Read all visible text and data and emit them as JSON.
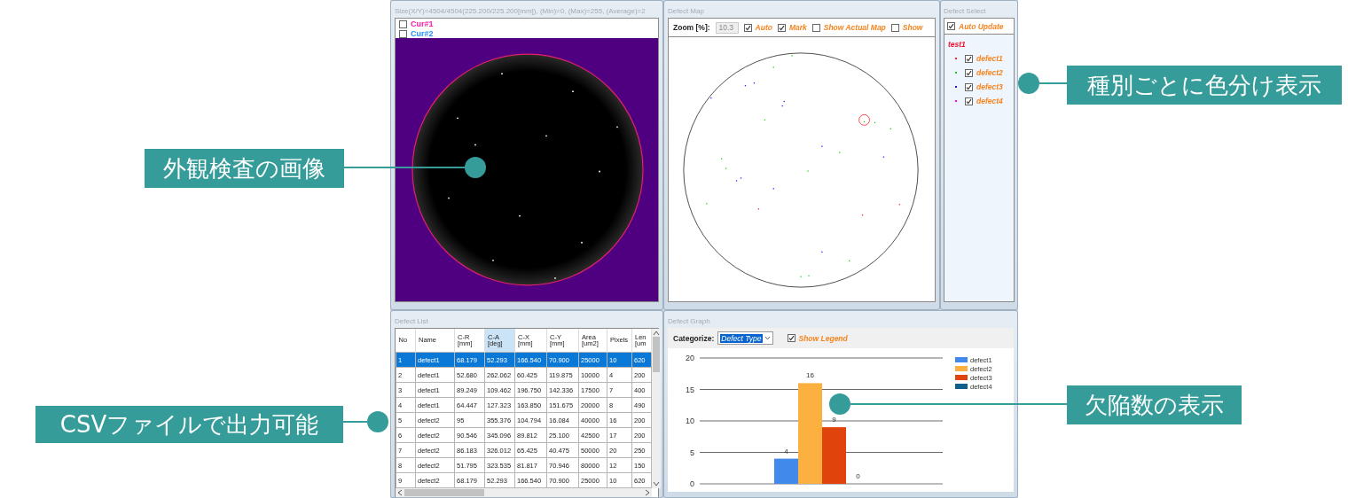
{
  "image_view": {
    "title": "Size(X/Y)=4504/4504(225.200/225.200[mm]), (Min)=0, (Max)=255, (Average)=2",
    "cursors": [
      {
        "label": "Cur#1",
        "checked": false,
        "color": "#ff1aa8"
      },
      {
        "label": "Cur#2",
        "checked": false,
        "color": "#1e90ff"
      }
    ]
  },
  "defect_map": {
    "title": "Defect Map",
    "zoom_label": "Zoom [%]:",
    "zoom_value": "10.3",
    "zoom_disabled": true,
    "options": [
      {
        "label": "Auto",
        "checked": true
      },
      {
        "label": "Mark",
        "checked": true
      },
      {
        "label": "Show Actual Map",
        "checked": false
      },
      {
        "label": "Show",
        "checked": false
      }
    ]
  },
  "defect_select": {
    "title": "Defect Select",
    "auto_update": {
      "label": "Auto Update",
      "checked": true
    },
    "tree": {
      "label": "test1",
      "children": [
        {
          "label": "defect1",
          "checked": true,
          "color": "#ff2020"
        },
        {
          "label": "defect2",
          "checked": true,
          "color": "#20d020"
        },
        {
          "label": "defect3",
          "checked": true,
          "color": "#1010ff"
        },
        {
          "label": "defect4",
          "checked": true,
          "color": "#ff00ff"
        }
      ]
    }
  },
  "defect_list": {
    "title": "Defect List",
    "columns": [
      {
        "label": "No",
        "highlighted": false
      },
      {
        "label": "Name",
        "highlighted": false
      },
      {
        "label": "C-R\n[mm]",
        "highlighted": false
      },
      {
        "label": "C-A\n[deg]",
        "highlighted": true
      },
      {
        "label": "C-X\n[mm]",
        "highlighted": false
      },
      {
        "label": "C-Y\n[mm]",
        "highlighted": false
      },
      {
        "label": "Area\n[um2]",
        "highlighted": false
      },
      {
        "label": "Pixels",
        "highlighted": false
      },
      {
        "label": "Len\n[um",
        "highlighted": false
      }
    ],
    "rows": [
      {
        "selected": true,
        "cells": [
          "1",
          "defect1",
          "68.179",
          "52.293",
          "166.540",
          "70.900",
          "25000",
          "10",
          "620"
        ]
      },
      {
        "selected": false,
        "cells": [
          "2",
          "defect1",
          "52.680",
          "262.062",
          "60.425",
          "119.875",
          "10000",
          "4",
          "200"
        ]
      },
      {
        "selected": false,
        "cells": [
          "3",
          "defect1",
          "89.249",
          "109.462",
          "196.750",
          "142.336",
          "17500",
          "7",
          "400"
        ]
      },
      {
        "selected": false,
        "cells": [
          "4",
          "defect1",
          "64.447",
          "127.323",
          "163.850",
          "151.675",
          "20000",
          "8",
          "490"
        ]
      },
      {
        "selected": false,
        "cells": [
          "5",
          "defect2",
          "95",
          "355.376",
          "104.794",
          "16.084",
          "40000",
          "16",
          "200"
        ]
      },
      {
        "selected": false,
        "cells": [
          "6",
          "defect2",
          "90.546",
          "345.096",
          "89.812",
          "25.100",
          "42500",
          "17",
          "200"
        ]
      },
      {
        "selected": false,
        "cells": [
          "7",
          "defect2",
          "86.183",
          "326.012",
          "65.425",
          "40.475",
          "50000",
          "20",
          "250"
        ]
      },
      {
        "selected": false,
        "cells": [
          "8",
          "defect2",
          "51.795",
          "323.535",
          "81.817",
          "70.946",
          "80000",
          "12",
          "150"
        ]
      },
      {
        "selected": false,
        "cells": [
          "9",
          "defect2",
          "68.179",
          "52.293",
          "166.540",
          "70.900",
          "25000",
          "10",
          "620"
        ]
      }
    ]
  },
  "defect_graph": {
    "title": "Defect Graph",
    "categorize_label": "Categorize:",
    "categorize_value": "Defect Type",
    "show_legend": {
      "label": "Show Legend",
      "checked": true
    },
    "chart_data": {
      "type": "bar",
      "ylim": [
        0,
        20
      ],
      "yticks": [
        {
          "value": 0,
          "label": "0"
        },
        {
          "value": 5,
          "label": "5"
        },
        {
          "value": 10,
          "label": "10"
        },
        {
          "value": 15,
          "label": "15"
        },
        {
          "value": 20,
          "label": "20"
        }
      ],
      "value_labels": [
        "4",
        "16",
        "9",
        "0"
      ],
      "grid": true,
      "legend": true,
      "series": [
        {
          "name": "defect1",
          "color": "#4189eb",
          "values": [
            4
          ]
        },
        {
          "name": "defect2",
          "color": "#fbb040",
          "values": [
            16
          ]
        },
        {
          "name": "defect3",
          "color": "#e0430c",
          "values": [
            9
          ]
        },
        {
          "name": "defect4",
          "color": "#0e5f8a",
          "values": [
            0
          ]
        }
      ]
    }
  },
  "callouts": [
    {
      "text": "外観検査の画像"
    },
    {
      "text": "CSVファイルで出力可能"
    },
    {
      "text": "種別ごとに色分け表示"
    },
    {
      "text": "欠陥数の表示"
    }
  ]
}
